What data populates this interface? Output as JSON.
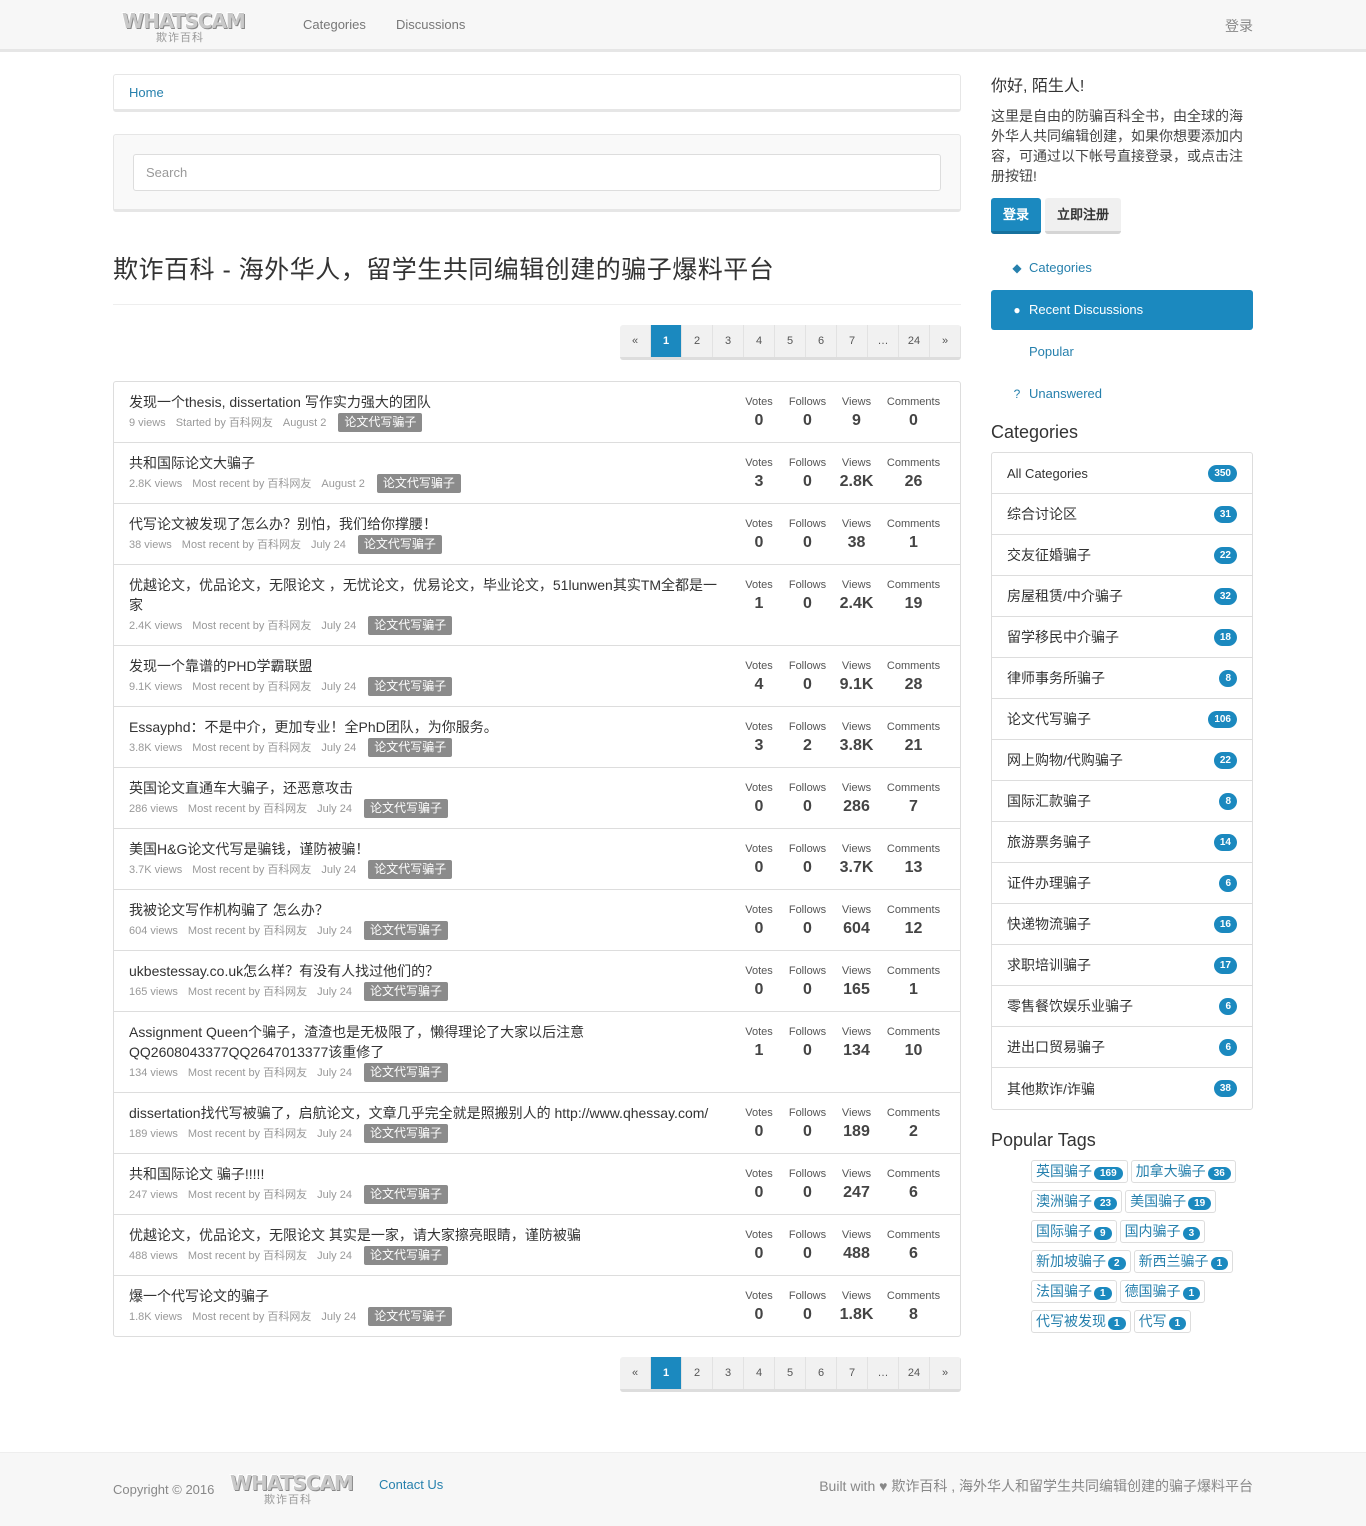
{
  "nav": {
    "logo_main": "WHATSCAM",
    "logo_sub": "欺诈百科",
    "links": [
      "Categories",
      "Discussions"
    ],
    "login": "登录"
  },
  "breadcrumb": "Home",
  "search": {
    "placeholder": "Search"
  },
  "page_title": "欺诈百科 - 海外华人，留学生共同编辑创建的骗子爆料平台",
  "pager": {
    "prev": "«",
    "next": "»",
    "pages": [
      "1",
      "2",
      "3",
      "4",
      "5",
      "6",
      "7",
      "…",
      "24"
    ],
    "active": "1"
  },
  "stat_labels": {
    "votes": "Votes",
    "follows": "Follows",
    "views": "Views",
    "comments": "Comments"
  },
  "topics": [
    {
      "title": "发现一个thesis, dissertation 写作实力强大的团队",
      "views": "9 views",
      "by": "Started by 百科网友",
      "date": "August 2",
      "tag": "论文代写骗子",
      "votes": "0",
      "follows": "0",
      "views_n": "9",
      "comments": "0"
    },
    {
      "title": "共和国际论文大骗子",
      "views": "2.8K views",
      "by": "Most recent by 百科网友",
      "date": "August 2",
      "tag": "论文代写骗子",
      "votes": "3",
      "follows": "0",
      "views_n": "2.8K",
      "comments": "26"
    },
    {
      "title": "代写论文被发现了怎么办？别怕，我们给你撑腰！",
      "views": "38 views",
      "by": "Most recent by 百科网友",
      "date": "July 24",
      "tag": "论文代写骗子",
      "votes": "0",
      "follows": "0",
      "views_n": "38",
      "comments": "1"
    },
    {
      "title": "优越论文，优品论文，无限论文 ，无忧论文，优易论文，毕业论文，51lunwen其实TM全都是一家",
      "views": "2.4K views",
      "by": "Most recent by 百科网友",
      "date": "July 24",
      "tag": "论文代写骗子",
      "votes": "1",
      "follows": "0",
      "views_n": "2.4K",
      "comments": "19"
    },
    {
      "title": "发现一个靠谱的PHD学霸联盟",
      "views": "9.1K views",
      "by": "Most recent by 百科网友",
      "date": "July 24",
      "tag": "论文代写骗子",
      "votes": "4",
      "follows": "0",
      "views_n": "9.1K",
      "comments": "28"
    },
    {
      "title": "Essayphd：不是中介，更加专业！全PhD团队，为你服务。",
      "views": "3.8K views",
      "by": "Most recent by 百科网友",
      "date": "July 24",
      "tag": "论文代写骗子",
      "votes": "3",
      "follows": "2",
      "views_n": "3.8K",
      "comments": "21"
    },
    {
      "title": "英国论文直通车大骗子，还恶意攻击",
      "views": "286 views",
      "by": "Most recent by 百科网友",
      "date": "July 24",
      "tag": "论文代写骗子",
      "votes": "0",
      "follows": "0",
      "views_n": "286",
      "comments": "7"
    },
    {
      "title": "美国H&G论文代写是骗钱，谨防被骗！",
      "views": "3.7K views",
      "by": "Most recent by 百科网友",
      "date": "July 24",
      "tag": "论文代写骗子",
      "votes": "0",
      "follows": "0",
      "views_n": "3.7K",
      "comments": "13"
    },
    {
      "title": "我被论文写作机构骗了 怎么办？",
      "views": "604 views",
      "by": "Most recent by 百科网友",
      "date": "July 24",
      "tag": "论文代写骗子",
      "votes": "0",
      "follows": "0",
      "views_n": "604",
      "comments": "12"
    },
    {
      "title": "ukbestessay.co.uk怎么样？有没有人找过他们的？",
      "views": "165 views",
      "by": "Most recent by 百科网友",
      "date": "July 24",
      "tag": "论文代写骗子",
      "votes": "0",
      "follows": "0",
      "views_n": "165",
      "comments": "1"
    },
    {
      "title": "Assignment Queen个骗子，渣渣也是无极限了，懒得理论了大家以后注意QQ2608043377QQ2647013377该重修了",
      "views": "134 views",
      "by": "Most recent by 百科网友",
      "date": "July 24",
      "tag": "论文代写骗子",
      "votes": "1",
      "follows": "0",
      "views_n": "134",
      "comments": "10"
    },
    {
      "title": "dissertation找代写被骗了，启航论文，文章几乎完全就是照搬别人的 http://www.qhessay.com/",
      "views": "189 views",
      "by": "Most recent by 百科网友",
      "date": "July 24",
      "tag": "论文代写骗子",
      "votes": "0",
      "follows": "0",
      "views_n": "189",
      "comments": "2"
    },
    {
      "title": "共和国际论文 骗子!!!!!",
      "views": "247 views",
      "by": "Most recent by 百科网友",
      "date": "July 24",
      "tag": "论文代写骗子",
      "votes": "0",
      "follows": "0",
      "views_n": "247",
      "comments": "6"
    },
    {
      "title": "优越论文，优品论文，无限论文 其实是一家，请大家擦亮眼睛，谨防被骗",
      "views": "488 views",
      "by": "Most recent by 百科网友",
      "date": "July 24",
      "tag": "论文代写骗子",
      "votes": "0",
      "follows": "0",
      "views_n": "488",
      "comments": "6"
    },
    {
      "title": "爆一个代写论文的骗子",
      "views": "1.8K views",
      "by": "Most recent by 百科网友",
      "date": "July 24",
      "tag": "论文代写骗子",
      "votes": "0",
      "follows": "0",
      "views_n": "1.8K",
      "comments": "8"
    }
  ],
  "sidebar": {
    "hello": "你好, 陌生人!",
    "intro": "这里是自由的防骗百科全书，由全球的海外华人共同编辑创建，如果你想要添加内容，可通过以下帐号直接登录，或点击注册按钮!",
    "login_btn": "登录",
    "register_btn": "立即注册",
    "nav": [
      {
        "label": "Categories",
        "icon": "tags-icon",
        "glyph": "◆"
      },
      {
        "label": "Recent Discussions",
        "icon": "comments-icon",
        "glyph": "●"
      },
      {
        "label": "Popular",
        "icon": "",
        "glyph": ""
      },
      {
        "label": "Unanswered",
        "icon": "question-icon",
        "glyph": "?"
      }
    ],
    "categories_title": "Categories",
    "categories": [
      {
        "name": "All Categories",
        "count": "350"
      },
      {
        "name": "综合讨论区",
        "count": "31"
      },
      {
        "name": "交友征婚骗子",
        "count": "22"
      },
      {
        "name": "房屋租赁/中介骗子",
        "count": "32"
      },
      {
        "name": "留学移民中介骗子",
        "count": "18"
      },
      {
        "name": "律师事务所骗子",
        "count": "8"
      },
      {
        "name": "论文代写骗子",
        "count": "106"
      },
      {
        "name": "网上购物/代购骗子",
        "count": "22"
      },
      {
        "name": "国际汇款骗子",
        "count": "8"
      },
      {
        "name": "旅游票务骗子",
        "count": "14"
      },
      {
        "name": "证件办理骗子",
        "count": "6"
      },
      {
        "name": "快递物流骗子",
        "count": "16"
      },
      {
        "name": "求职培训骗子",
        "count": "17"
      },
      {
        "name": "零售餐饮娱乐业骗子",
        "count": "6"
      },
      {
        "name": "进出口贸易骗子",
        "count": "6"
      },
      {
        "name": "其他欺诈/诈骗",
        "count": "38"
      }
    ],
    "tags_title": "Popular Tags",
    "tags": [
      {
        "name": "英国骗子",
        "count": "169"
      },
      {
        "name": "加拿大骗子",
        "count": "36"
      },
      {
        "name": "澳洲骗子",
        "count": "23"
      },
      {
        "name": "美国骗子",
        "count": "19"
      },
      {
        "name": "国际骗子",
        "count": "9"
      },
      {
        "name": "国内骗子",
        "count": "3"
      },
      {
        "name": "新加坡骗子",
        "count": "2"
      },
      {
        "name": "新西兰骗子",
        "count": "1"
      },
      {
        "name": "法国骗子",
        "count": "1"
      },
      {
        "name": "德国骗子",
        "count": "1"
      },
      {
        "name": "代写被发现",
        "count": "1"
      },
      {
        "name": "代写",
        "count": "1"
      }
    ]
  },
  "footer": {
    "copyright": "Copyright © 2016",
    "contact": "Contact Us",
    "built_prefix": "Built with",
    "built_suffix": "欺诈百科 , 海外华人和留学生共同编辑创建的骗子爆料平台"
  },
  "colors": {
    "accent": "#1b89bf",
    "link": "#2680ad",
    "tag_bg": "#8b8b8b"
  }
}
